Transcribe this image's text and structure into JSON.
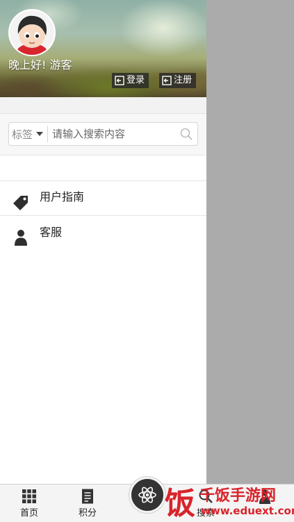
{
  "header": {
    "greeting": "晚上好! 游客",
    "login_label": "登录",
    "register_label": "注册"
  },
  "search": {
    "category": "标签",
    "placeholder": "请输入搜索内容"
  },
  "menu": {
    "items": [
      {
        "label": "用户指南",
        "icon": "tag-icon"
      },
      {
        "label": "客服",
        "icon": "person-icon"
      }
    ]
  },
  "bottom_nav": {
    "tabs": [
      {
        "label": "首页",
        "icon": "grid-icon"
      },
      {
        "label": "积分",
        "icon": "document-icon"
      },
      {
        "label": "",
        "icon": "atom-icon"
      },
      {
        "label": "搜索",
        "icon": "search-icon"
      },
      {
        "label": "",
        "icon": "person-icon"
      }
    ]
  },
  "watermark": {
    "logo_char": "饭",
    "title": "千饭手游网",
    "url": "www.eduext.com"
  },
  "colors": {
    "overlay": "#ababab",
    "watermark_red": "#d9232b",
    "bottom_bar": "#f4f4f4",
    "center_button": "#333333"
  }
}
